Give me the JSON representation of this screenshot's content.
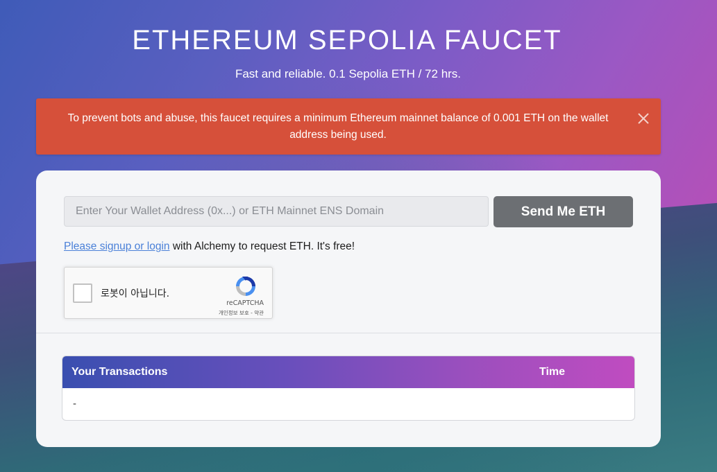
{
  "header": {
    "title": "ETHEREUM SEPOLIA FAUCET",
    "subtitle": "Fast and reliable. 0.1 Sepolia ETH / 72 hrs."
  },
  "alert": {
    "message": "To prevent bots and abuse, this faucet requires a minimum Ethereum mainnet balance of 0.001 ETH on the wallet address being used.",
    "close_icon": "close-icon",
    "color": "#d6503a"
  },
  "form": {
    "wallet_placeholder": "Enter Your Wallet Address (0x...) or ETH Mainnet ENS Domain",
    "wallet_value": "",
    "send_label": "Send Me ETH",
    "signup_link": "Please signup or login",
    "signup_rest": " with Alchemy to request ETH. It's free!"
  },
  "captcha": {
    "label": "로봇이 아닙니다.",
    "brand": "reCAPTCHA",
    "terms": "개인정보 보호 - 약관"
  },
  "transactions": {
    "col_tx": "Your Transactions",
    "col_time": "Time",
    "empty": "-"
  }
}
